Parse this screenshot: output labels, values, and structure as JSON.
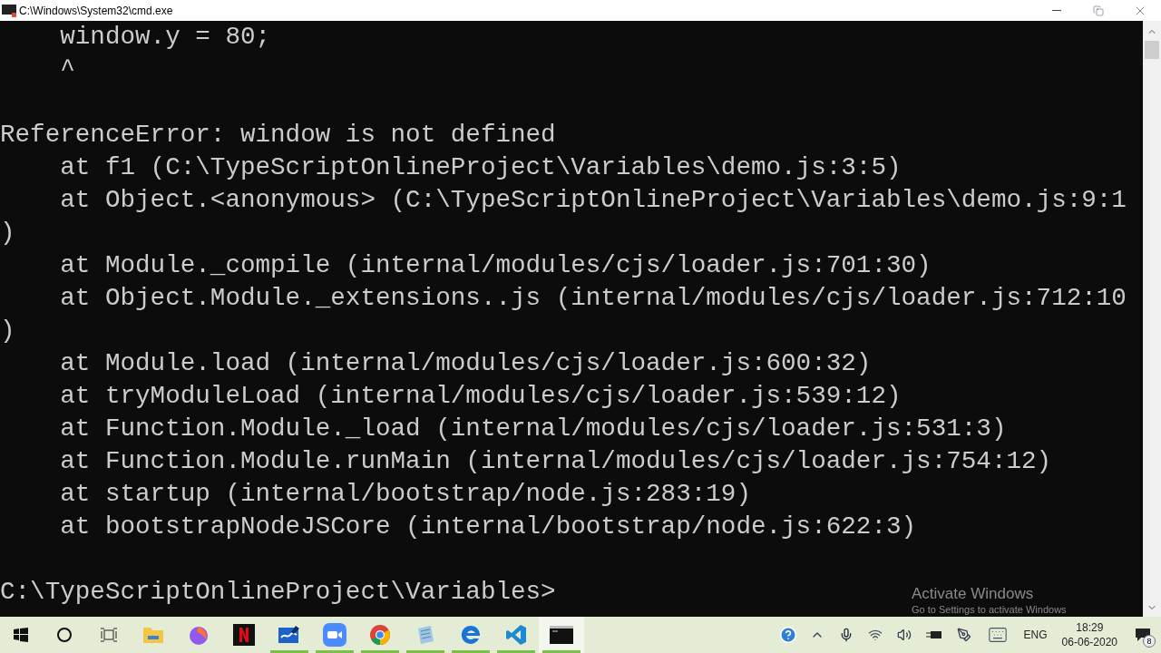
{
  "window": {
    "title": "C:\\Windows\\System32\\cmd.exe"
  },
  "console": {
    "blocks": [
      [
        "    window.y = 80;",
        "    ^"
      ],
      [
        "ReferenceError: window is not defined",
        "    at f1 (C:\\TypeScriptOnlineProject\\Variables\\demo.js:3:5)",
        "    at Object.<anonymous> (C:\\TypeScriptOnlineProject\\Variables\\demo.js:9:1",
        ")",
        "    at Module._compile (internal/modules/cjs/loader.js:701:30)",
        "    at Object.Module._extensions..js (internal/modules/cjs/loader.js:712:10",
        ")",
        "    at Module.load (internal/modules/cjs/loader.js:600:32)",
        "    at tryModuleLoad (internal/modules/cjs/loader.js:539:12)",
        "    at Function.Module._load (internal/modules/cjs/loader.js:531:3)",
        "    at Function.Module.runMain (internal/modules/cjs/loader.js:754:12)",
        "    at startup (internal/bootstrap/node.js:283:19)",
        "    at bootstrapNodeJSCore (internal/bootstrap/node.js:622:3)"
      ],
      [
        "C:\\TypeScriptOnlineProject\\Variables>"
      ]
    ]
  },
  "activation_notice": {
    "title": "Activate Windows",
    "text": "Go to Settings to activate Windows"
  },
  "taskbar": {
    "apps": [
      {
        "kind": "explorer",
        "running": false,
        "selected": false
      },
      {
        "kind": "firefox",
        "running": false,
        "selected": false
      },
      {
        "kind": "netflix",
        "running": false,
        "selected": false
      },
      {
        "kind": "whiteboard",
        "running": true,
        "selected": false
      },
      {
        "kind": "zoom",
        "running": true,
        "selected": false
      },
      {
        "kind": "chrome",
        "running": true,
        "selected": false
      },
      {
        "kind": "notepad",
        "running": true,
        "selected": false
      },
      {
        "kind": "edge",
        "running": true,
        "selected": false
      },
      {
        "kind": "vscode",
        "running": true,
        "selected": false
      },
      {
        "kind": "terminal",
        "running": true,
        "selected": true
      }
    ],
    "language": "ENG",
    "time": "18:29",
    "date": "06-06-2020",
    "notification_count": "8"
  }
}
